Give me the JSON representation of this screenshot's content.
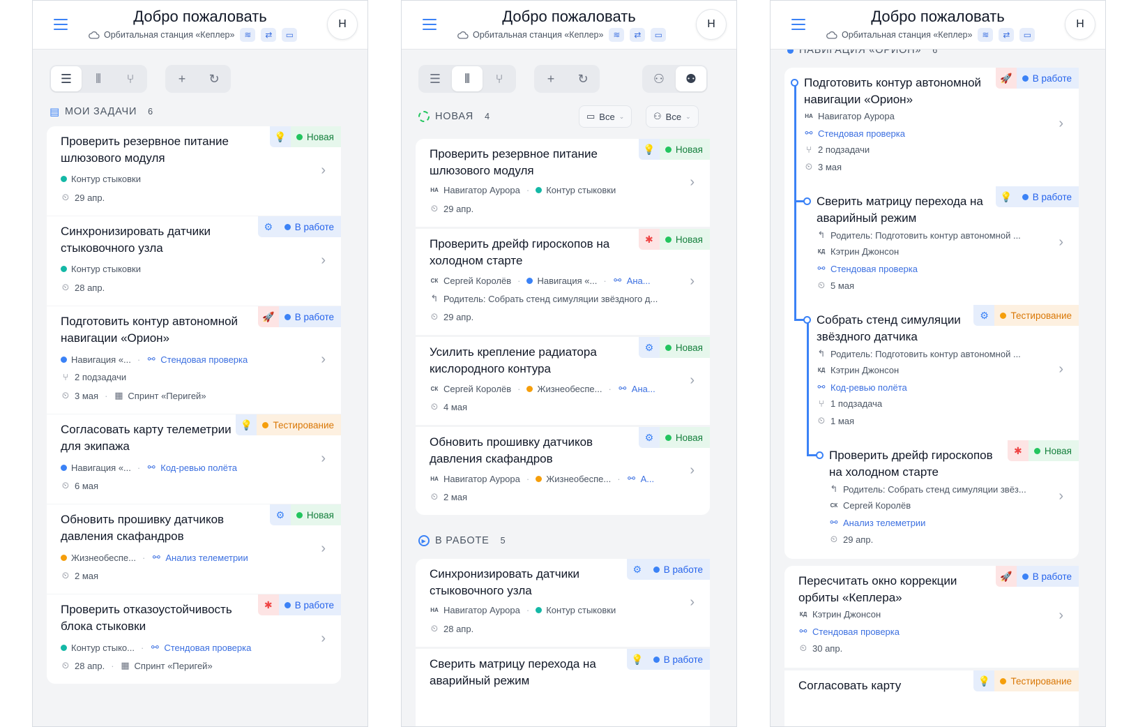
{
  "header": {
    "title": "Добро пожаловать",
    "station": "Орбитальная станция «Кеплер»",
    "avatar": "Н"
  },
  "colors": {
    "accent": "#3b82f6",
    "new": "#22c55e",
    "in_progress": "#3b82f6",
    "testing": "#f59e0b",
    "bug": "#ef4444"
  },
  "panel1": {
    "section_title": "МОИ ЗАДАЧИ",
    "section_count": "6",
    "tasks": [
      {
        "title": "Проверить резервное питание шлюзового модуля",
        "type_icon": "lightbulb-icon",
        "status": "Новая",
        "meta1_dot": "#14b8a6",
        "meta1": "Контур стыковки",
        "date": "29 апр."
      },
      {
        "title": "Синхронизировать датчики стыковочного узла",
        "type_icon": "gear-icon",
        "status": "В работе",
        "meta1_dot": "#14b8a6",
        "meta1": "Контур стыковки",
        "date": "28 апр."
      },
      {
        "title": "Подготовить контур автономной навигации «Орион»",
        "type_icon": "rocket-icon",
        "status": "В работе",
        "meta1_dot": "#3b82f6",
        "meta1": "Навигация «...",
        "link": "Стендовая проверка",
        "subtasks": "2 подзадачи",
        "date": "3 мая",
        "sprint": "Спринт «Перигей»"
      },
      {
        "title": "Согласовать карту телеметрии для экипажа",
        "type_icon": "lightbulb-icon",
        "status": "Тестирование",
        "meta1_dot": "#3b82f6",
        "meta1": "Навигация «...",
        "link": "Код-ревью полёта",
        "date": "6 мая"
      },
      {
        "title": "Обновить прошивку датчиков давления скафандров",
        "type_icon": "gear-icon",
        "status": "Новая",
        "meta1_dot": "#f59e0b",
        "meta1": "Жизнеобеспе...",
        "link": "Анализ телеметрии",
        "date": "2 мая"
      },
      {
        "title": "Проверить отказоустойчивость блока стыковки",
        "type_icon": "bug-icon",
        "status": "В работе",
        "meta1_dot": "#14b8a6",
        "meta1": "Контур стыко...",
        "link": "Стендовая проверка",
        "date": "28 апр.",
        "sprint": "Спринт «Перигей»"
      }
    ]
  },
  "panel2": {
    "filter_project": "Все",
    "filter_user": "Все",
    "group_new": {
      "title": "НОВАЯ",
      "count": "4"
    },
    "group_work": {
      "title": "В РАБОТЕ",
      "count": "5"
    },
    "tasks_new": [
      {
        "title": "Проверить резервное питание шлюзового модуля",
        "status": "Новая",
        "initials": "НА",
        "person": "Навигатор Аурора",
        "dot": "#14b8a6",
        "project": "Контур стыковки",
        "date": "29 апр."
      },
      {
        "title": "Проверить дрейф гироскопов на холодном старте",
        "status": "Новая",
        "initials": "СК",
        "person": "Сергей Королёв",
        "dot": "#3b82f6",
        "project": "Навигация «...",
        "link": "Ана...",
        "parent": "Родитель: Собрать стенд симуляции звёздного д...",
        "date": "29 апр."
      },
      {
        "title": "Усилить крепление радиатора кислородного контура",
        "status": "Новая",
        "initials": "СК",
        "person": "Сергей Королёв",
        "dot": "#f59e0b",
        "project": "Жизнеобеспе...",
        "link": "Ана...",
        "date": "4 мая"
      },
      {
        "title": "Обновить прошивку датчиков давления скафандров",
        "status": "Новая",
        "initials": "НА",
        "person": "Навигатор Аурора",
        "dot": "#f59e0b",
        "project": "Жизнеобеспе...",
        "link": "А...",
        "date": "2 мая"
      }
    ],
    "tasks_work": [
      {
        "title": "Синхронизировать датчики стыковочного узла",
        "status": "В работе",
        "initials": "НА",
        "person": "Навигатор Аурора",
        "dot": "#14b8a6",
        "project": "Контур стыковки",
        "date": "28 апр."
      },
      {
        "title": "Сверить матрицу перехода на аварийный режим",
        "status": "В работе"
      }
    ]
  },
  "panel3": {
    "group_title": "НАВИГАЦИЯ «ОРИОН»",
    "group_count": "6",
    "tree": [
      {
        "title": "Подготовить контур автономной навигации «Орион»",
        "status": "В работе",
        "initials": "НА",
        "person": "Навигатор Аурора",
        "link": "Стендовая проверка",
        "subtasks": "2 подзадачи",
        "date": "3 мая"
      },
      {
        "title": "Сверить матрицу перехода на аварийный режим",
        "status": "В работе",
        "parent": "Родитель: Подготовить контур автономной ...",
        "initials": "КД",
        "person": "Кэтрин Джонсон",
        "link": "Стендовая проверка",
        "date": "5 мая"
      },
      {
        "title": "Собрать стенд симуляции звёздного датчика",
        "status": "Тестирование",
        "parent": "Родитель: Подготовить контур автономной ...",
        "initials": "КД",
        "person": "Кэтрин Джонсон",
        "link": "Код-ревью полёта",
        "subtasks": "1 подзадача",
        "date": "1 мая"
      },
      {
        "title": "Проверить дрейф гироскопов на холодном старте",
        "status": "Новая",
        "parent": "Родитель: Собрать стенд симуляции звёз...",
        "initials": "СК",
        "person": "Сергей Королёв",
        "link": "Анализ телеметрии",
        "date": "29 апр."
      }
    ],
    "tasks": [
      {
        "title": "Пересчитать окно коррекции орбиты «Кеплера»",
        "status": "В работе",
        "initials": "КД",
        "person": "Кэтрин Джонсон",
        "link": "Стендовая проверка",
        "date": "30 апр."
      },
      {
        "title": "Согласовать карту",
        "status": "Тестирование"
      }
    ]
  }
}
